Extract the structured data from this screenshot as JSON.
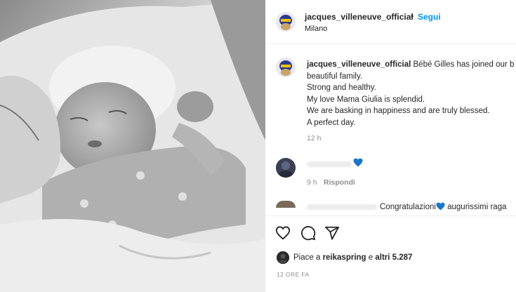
{
  "post": {
    "username": "jacques_villeneuve_official",
    "dot": "•",
    "follow_label": "Segui",
    "location": "Milano"
  },
  "caption": {
    "username": "jacques_villeneuve_official",
    "lines": [
      "Bébé Gilles has joined our b",
      "beautiful family.",
      "Strong and healthy.",
      "My love Mama Giulia is splendid.",
      "We are basking in happiness and are truly blessed.",
      "A perfect day."
    ],
    "time": "12 h"
  },
  "comments": [
    {
      "time": "9 h",
      "reply_label": "Rispondi"
    },
    {
      "text_a": "Congratulazioni",
      "text_b": " augurissimi raga"
    }
  ],
  "likes": {
    "prefix": "Piace a ",
    "user": "reikaspring",
    "middle": " e ",
    "others": "altri 5.287"
  },
  "date": "12 ORE FA",
  "icons": [
    "heart-outline-icon",
    "comment-icon",
    "share-icon",
    "blue-heart-icon"
  ],
  "colors": {
    "link_blue": "#0095f6",
    "heart_blue": "#1877c9",
    "muted": "#8e8e8e"
  }
}
